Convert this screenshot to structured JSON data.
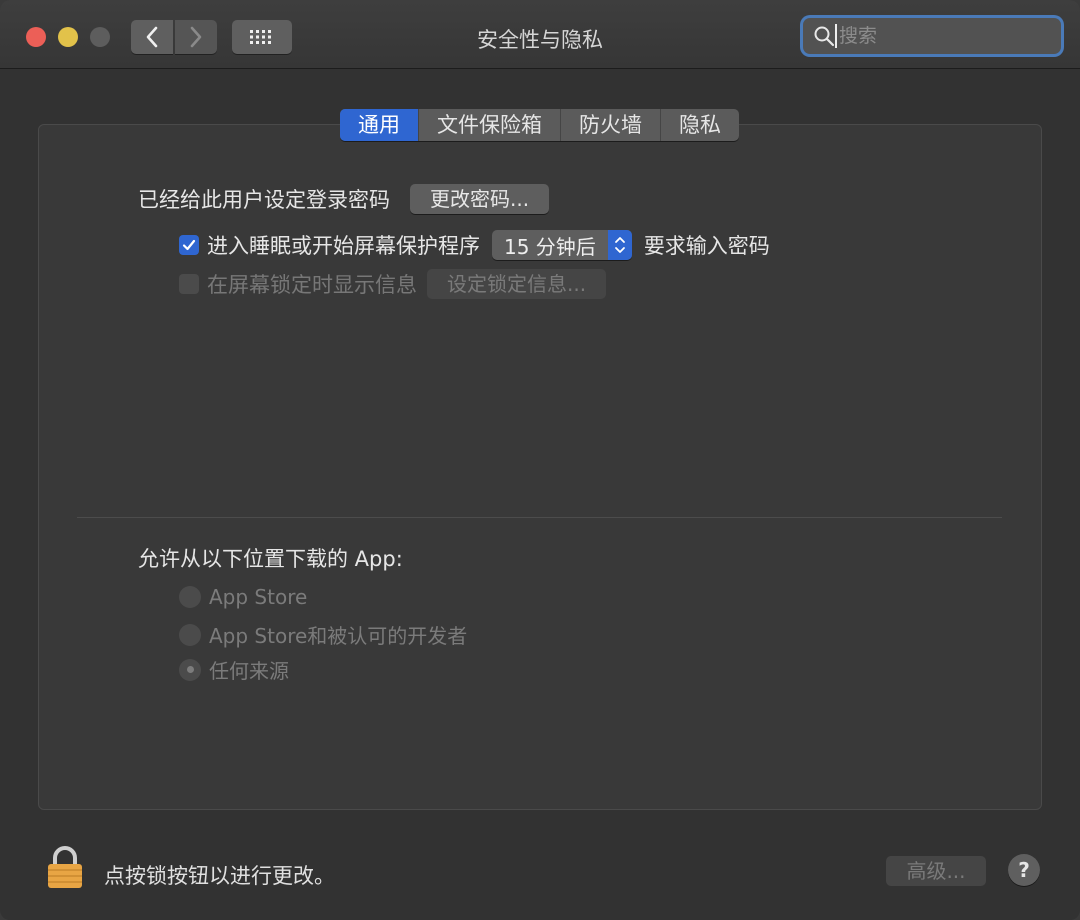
{
  "window": {
    "title": "安全性与隐私"
  },
  "toolbar": {
    "back_icon": "chevron-left-icon",
    "forward_icon": "chevron-right-icon",
    "grid_icon": "grid-icon",
    "search_placeholder": "搜索",
    "search_value": ""
  },
  "tabs": [
    {
      "label": "通用",
      "active": true
    },
    {
      "label": "文件保险箱",
      "active": false
    },
    {
      "label": "防火墙",
      "active": false
    },
    {
      "label": "隐私",
      "active": false
    }
  ],
  "general": {
    "password_label": "已经给此用户设定登录密码",
    "change_password_button": "更改密码...",
    "require_password": {
      "checked": true,
      "label": "进入睡眠或开始屏幕保护程序",
      "delay_value": "15 分钟后",
      "suffix": "要求输入密码"
    },
    "lock_message": {
      "checked": false,
      "label": "在屏幕锁定时显示信息",
      "button": "设定锁定信息..."
    }
  },
  "downloads": {
    "label": "允许从以下位置下载的 App:",
    "options": [
      {
        "label": "App Store",
        "selected": false
      },
      {
        "label": "App Store和被认可的开发者",
        "selected": false
      },
      {
        "label": "任何来源",
        "selected": true
      }
    ]
  },
  "footer": {
    "lock_text": "点按锁按钮以进行更改。",
    "advanced_button": "高级...",
    "help_button": "?"
  },
  "colors": {
    "accent": "#2f66d1",
    "close": "#ec5f57",
    "minimize": "#e2c24a",
    "zoom": "#5d5d5d",
    "lock": "#e8a544"
  }
}
